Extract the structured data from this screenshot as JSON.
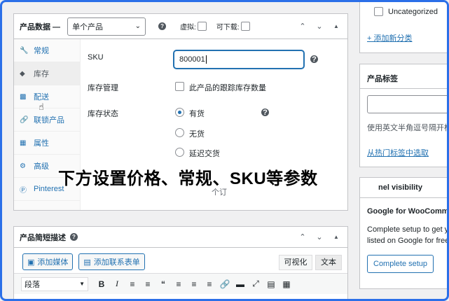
{
  "product_data": {
    "title": "产品数据 —",
    "type_select": "单个产品",
    "virtual_label": "虚拟:",
    "downloadable_label": "可下载:",
    "tabs": [
      {
        "label": "常规",
        "icon": "wrench-icon"
      },
      {
        "label": "库存",
        "icon": "tag-icon"
      },
      {
        "label": "配送",
        "icon": "truck-icon"
      },
      {
        "label": "联锁产品",
        "icon": "link-icon"
      },
      {
        "label": "属性",
        "icon": "table-icon"
      },
      {
        "label": "高级",
        "icon": "gear-icon"
      },
      {
        "label": "Pinterest",
        "icon": "pinterest-icon"
      }
    ],
    "sku_label": "SKU",
    "sku_value": "800001",
    "stock_mgmt_label": "库存管理",
    "stock_mgmt_checkbox_label": "此产品的跟踪库存数量",
    "stock_status_label": "库存状态",
    "stock_options": [
      "有货",
      "无货",
      "延迟交货"
    ],
    "hidden_partial_text": "个订"
  },
  "short_desc": {
    "title": "产品简短描述",
    "add_media": "添加媒体",
    "add_form": "添加联系表单",
    "tab_visual": "可视化",
    "tab_text": "文本",
    "paragraph_select": "段落"
  },
  "categories": {
    "uncategorized_label": "Uncategorized",
    "add_new": "+ 添加新分类"
  },
  "tags": {
    "title": "产品标签",
    "hint": "使用英文半角逗号隔开标",
    "popular_link": "从热门标签中选取"
  },
  "channel": {
    "title_partial": "nel visibility",
    "google_title": "Google for WooComme",
    "desc_line1": "Complete setup to get y",
    "desc_line2": "listed on Google for free",
    "setup_button": "Complete setup"
  },
  "overlay_caption": "下方设置价格、常规、SKU等参数",
  "accent_color": "#2271b1"
}
